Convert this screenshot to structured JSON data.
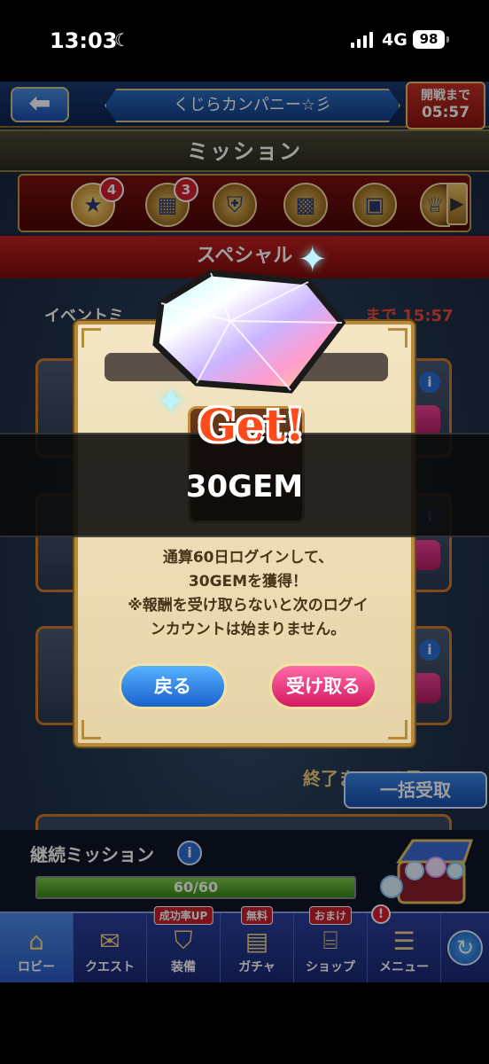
{
  "status_bar": {
    "time": "13:03",
    "network": "4G",
    "battery": "98"
  },
  "header": {
    "team_name": "くじらカンパニー☆彡",
    "battle_label": "開戦まで",
    "battle_time": "05:57"
  },
  "page_title": "ミッション",
  "tabs": [
    {
      "icon": "star-icon",
      "badge": "4",
      "selected": true
    },
    {
      "icon": "calendar-icon",
      "badge": "3"
    },
    {
      "icon": "shield-swords-icon",
      "badge": ""
    },
    {
      "icon": "gold-grid-icon",
      "badge": ""
    },
    {
      "icon": "grid-shield-icon",
      "badge": ""
    },
    {
      "icon": "trophy-icon",
      "badge": ""
    }
  ],
  "section_title": "スペシャル",
  "event_label": "イベントミ",
  "event_time": "まで 15:57",
  "end_text": "終了まで 13日",
  "bulk_button": "一括受取",
  "continuous": {
    "title": "継続ミッション",
    "progress_text": "60/60",
    "progress": 1.0
  },
  "nav": [
    {
      "label": "ロビー",
      "icon": "castle-icon",
      "selected": true
    },
    {
      "label": "クエスト",
      "icon": "scroll-icon",
      "tag": ""
    },
    {
      "label": "装備",
      "icon": "armor-icon",
      "tag": "成功率UP"
    },
    {
      "label": "ガチャ",
      "icon": "chest-icon",
      "tag": "無料"
    },
    {
      "label": "ショップ",
      "icon": "shop-icon",
      "tag": "おまけ"
    },
    {
      "label": "メニュー",
      "icon": "menu-icon",
      "alert": "!"
    }
  ],
  "dialog": {
    "get_label": "Get!",
    "reward": "30GEM",
    "message_lines": [
      "通算60日ログインして、",
      "30GEMを獲得！",
      "※報酬を受け取らないと次のログイ",
      "ンカウントは始まりません。"
    ],
    "back_button": "戻る",
    "receive_button": "受け取る"
  },
  "colors": {
    "accent_red": "#c42020",
    "accent_blue": "#1a4fb0",
    "dialog_bg": "#f4e6c4",
    "gem_text_red": "#ff4a1a"
  }
}
